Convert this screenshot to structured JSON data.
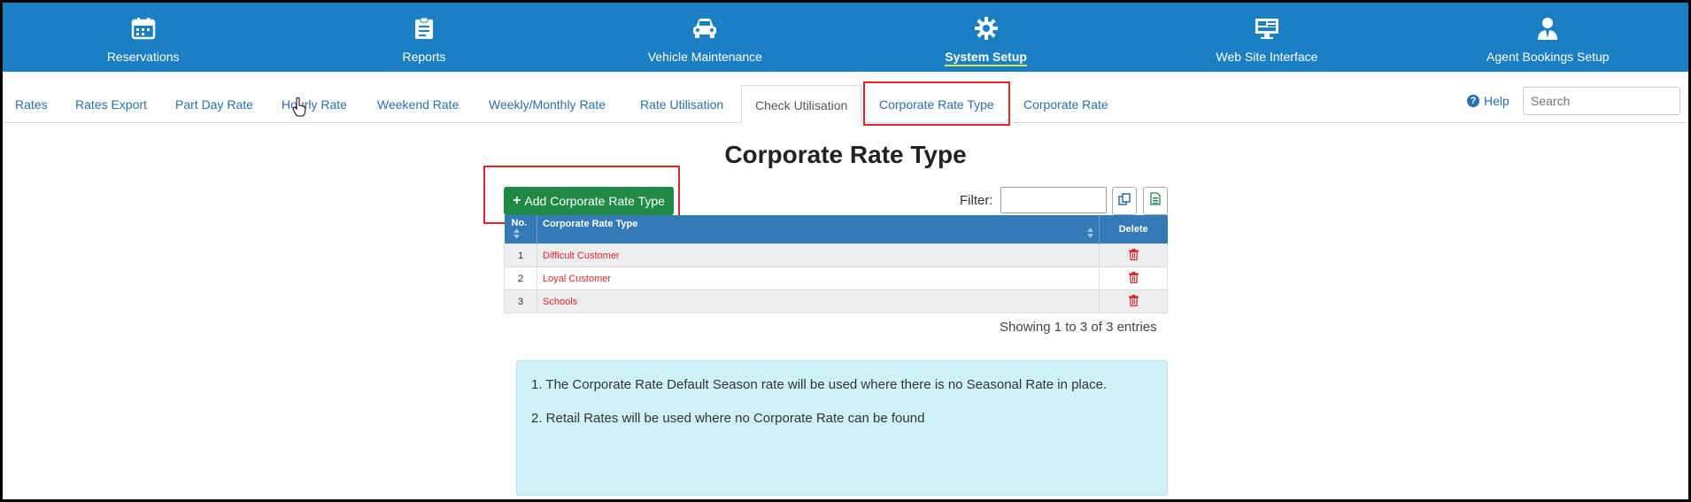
{
  "topnav": {
    "items": [
      {
        "label": "Reservations",
        "icon": "calendar-icon",
        "active": false
      },
      {
        "label": "Reports",
        "icon": "clipboard-icon",
        "active": false
      },
      {
        "label": "Vehicle Maintenance",
        "icon": "car-icon",
        "active": false
      },
      {
        "label": "System Setup",
        "icon": "gear-icon",
        "active": true
      },
      {
        "label": "Web Site Interface",
        "icon": "monitor-icon",
        "active": false
      },
      {
        "label": "Agent Bookings Setup",
        "icon": "agent-icon",
        "active": false
      }
    ]
  },
  "subtabs": {
    "items": [
      {
        "label": "Rates"
      },
      {
        "label": "Rates Export"
      },
      {
        "label": "Part Day Rate"
      },
      {
        "label": "Hourly Rate"
      },
      {
        "label": "Weekend Rate"
      },
      {
        "label": "Weekly/Monthly Rate"
      },
      {
        "label": "Rate Utilisation"
      },
      {
        "label": "Check Utilisation"
      },
      {
        "label": "Corporate Rate Type"
      },
      {
        "label": "Corporate Rate"
      }
    ],
    "active": "Check Utilisation"
  },
  "help_label": "Help",
  "search": {
    "placeholder": "Search",
    "value": ""
  },
  "page_title": "Corporate Rate Type",
  "add_button_label": "Add Corporate Rate Type",
  "filter_label": "Filter:",
  "table": {
    "headers": {
      "no": "No.",
      "type": "Corporate Rate Type",
      "delete": "Delete"
    },
    "rows": [
      {
        "no": "1",
        "type": "Difficult Customer"
      },
      {
        "no": "2",
        "type": "Loyal Customer"
      },
      {
        "no": "3",
        "type": "Schools"
      }
    ]
  },
  "showing_text": "Showing 1 to 3 of 3 entries",
  "info": {
    "line1": "1. The Corporate Rate Default Season rate will be used where there is no Seasonal Rate in place.",
    "line2": "2. Retail Rates will be used where no Corporate Rate can be found"
  },
  "colors": {
    "nav_bg": "#1b7fc4",
    "add_button": "#1f8a45",
    "table_header": "#337ab7",
    "link": "#2a6fb0",
    "danger": "#e0262b",
    "info_bg": "#cff2f9"
  }
}
